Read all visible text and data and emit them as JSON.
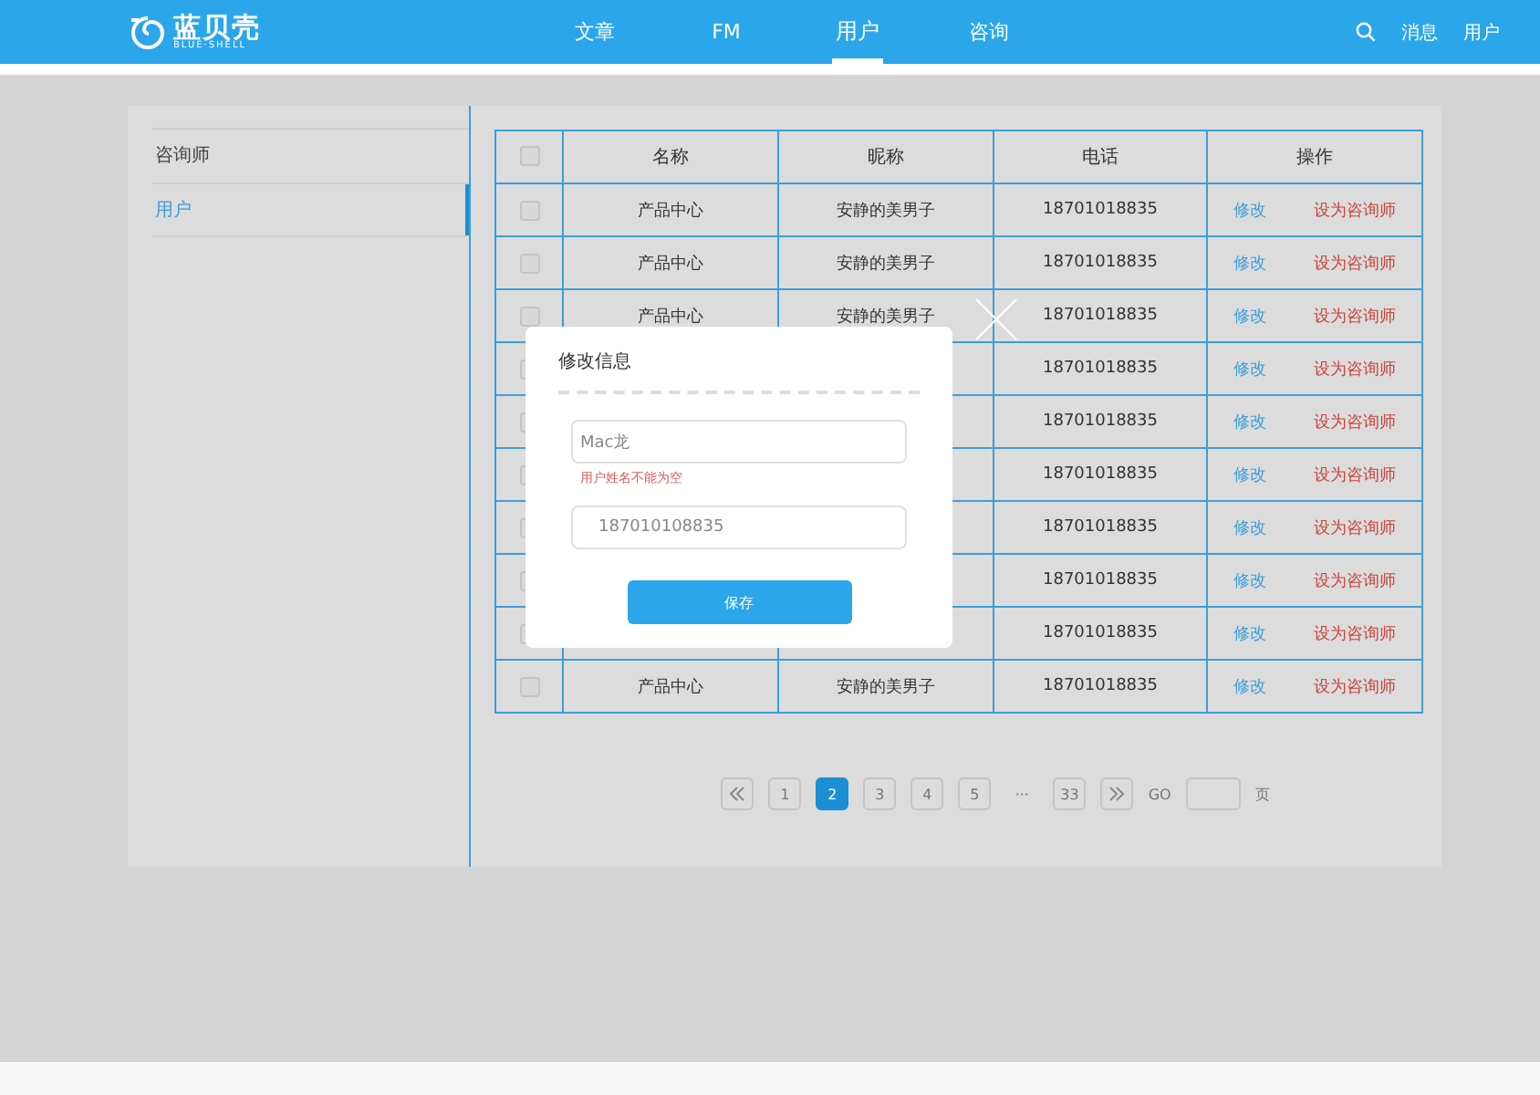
{
  "header": {
    "logo": {
      "name": "蓝贝壳",
      "subtitle": "BLUE·SHELL"
    },
    "nav": [
      {
        "label": "文章",
        "selected": false
      },
      {
        "label": "FM",
        "selected": false
      },
      {
        "label": "用户",
        "selected": true
      },
      {
        "label": "咨询",
        "selected": false
      }
    ],
    "actions": [
      "消息",
      "用户"
    ]
  },
  "sidebar": {
    "items": [
      {
        "label": "咨询师",
        "selected": false
      },
      {
        "label": "用户",
        "selected": true
      }
    ]
  },
  "table": {
    "select_all_checked": false,
    "columns": [
      "名称",
      "昵称",
      "电话",
      "操作"
    ],
    "rows": [
      {
        "checked": false,
        "name": "产品中心",
        "nickname": "安静的美男子",
        "phone": "18701018835",
        "edit": "修改",
        "promote": "设为咨询师"
      },
      {
        "checked": false,
        "name": "产品中心",
        "nickname": "安静的美男子",
        "phone": "18701018835",
        "edit": "修改",
        "promote": "设为咨询师"
      },
      {
        "checked": false,
        "name": "产品中心",
        "nickname": "安静的美男子",
        "phone": "18701018835",
        "edit": "修改",
        "promote": "设为咨询师"
      },
      {
        "checked": false,
        "phone": "18701018835",
        "edit": "修改",
        "promote": "设为咨询师"
      },
      {
        "checked": false,
        "phone": "18701018835",
        "edit": "修改",
        "promote": "设为咨询师"
      },
      {
        "checked": false,
        "phone": "18701018835",
        "edit": "修改",
        "promote": "设为咨询师"
      },
      {
        "checked": false,
        "phone": "18701018835",
        "edit": "修改",
        "promote": "设为咨询师"
      },
      {
        "checked": false,
        "phone": "18701018835",
        "edit": "修改",
        "promote": "设为咨询师"
      },
      {
        "checked": false,
        "phone": "18701018835",
        "edit": "修改",
        "promote": "设为咨询师"
      },
      {
        "checked": false,
        "name": "产品中心",
        "nickname": "安静的美男子",
        "phone": "18701018835",
        "edit": "修改",
        "promote": "设为咨询师"
      }
    ]
  },
  "pagination": {
    "pages": [
      {
        "label": "1",
        "selected": false
      },
      {
        "label": "2",
        "selected": true
      },
      {
        "label": "3",
        "selected": false
      },
      {
        "label": "4",
        "selected": false
      },
      {
        "label": "5",
        "selected": false
      },
      {
        "label": "···",
        "kind": "ellipsis"
      },
      {
        "label": "33",
        "selected": false
      }
    ],
    "go": "GO",
    "unit": "页"
  },
  "dialog": {
    "title": "修改信息",
    "name_field": {
      "value": "Mac龙"
    },
    "error": "用户姓名不能为空",
    "phone_field": {
      "value": "187010108835"
    },
    "save": "保存"
  }
}
